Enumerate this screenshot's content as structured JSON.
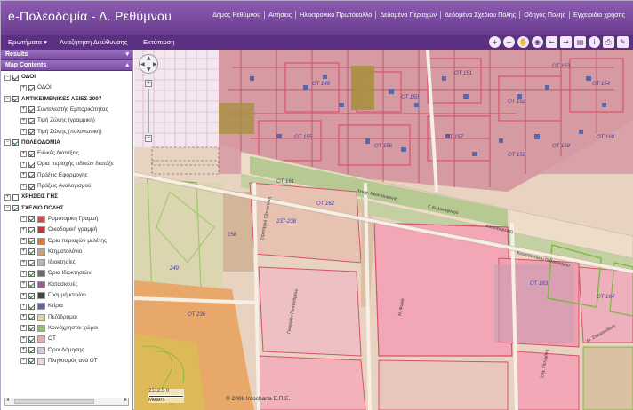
{
  "header": {
    "title": "e-Πολεοδομία - Δ. Ρεθύμνου",
    "nav": [
      "Δήμος Ρεθύμνου",
      "Αιτήσεις",
      "Ηλεκτρονικό Πρωτόκολλο",
      "Δεδομένα Περιοχών",
      "Δεδομένα Σχεδίου Πόλης",
      "Οδηγός Πόλης",
      "Εγχειρίδιο χρήσης"
    ]
  },
  "toolbar": {
    "menu_queries": "Ερωτήματα",
    "menu_address": "Αναζήτηση Διεύθυνσης",
    "menu_print": "Εκτύπωση",
    "tools": [
      "zoom-in-icon",
      "zoom-out-icon",
      "pan-hand-icon",
      "globe-icon",
      "back-arrow-icon",
      "forward-arrow-icon",
      "layers-icon",
      "info-icon",
      "print-icon",
      "measure-icon"
    ]
  },
  "left_panel": {
    "results_label": "Results",
    "map_contents_label": "Map Contents"
  },
  "tree": [
    {
      "label": "ΟΔΟΙ",
      "level": 0,
      "group": true,
      "checked": true,
      "expander": "−"
    },
    {
      "label": "ΟΔΟΙ",
      "level": 1,
      "checked": true,
      "expander": "+"
    },
    {
      "label": "ΑΝΤΙΚΕΙΜΕΝΙΚΕΣ ΑΞΙΕΣ 2007",
      "level": 0,
      "group": true,
      "checked": true,
      "expander": "−"
    },
    {
      "label": "Συντελεστής Εμπορικότητας",
      "level": 1,
      "checked": true,
      "expander": "+"
    },
    {
      "label": "Τιμή Ζώνης (γραμμική)",
      "level": 1,
      "checked": true,
      "expander": "+"
    },
    {
      "label": "Τιμή Ζώνης (πολυγωνική)",
      "level": 1,
      "checked": true,
      "expander": "+"
    },
    {
      "label": "ΠΟΛΕΟΔΟΜΙΑ",
      "level": 0,
      "group": true,
      "checked": true,
      "expander": "−"
    },
    {
      "label": "Ειδικές Διατάξεις",
      "level": 1,
      "checked": true,
      "expander": "+"
    },
    {
      "label": "Όρια περιοχής ειδικών διατάξε",
      "level": 1,
      "checked": true,
      "expander": "+"
    },
    {
      "label": "Πράξεις Εφαρμογής",
      "level": 1,
      "checked": true,
      "expander": "+"
    },
    {
      "label": "Πράξεις Αναλογισμού",
      "level": 1,
      "checked": true,
      "expander": "+"
    },
    {
      "label": "ΧΡΗΣΕΙΣ ΓΗΣ",
      "level": 0,
      "group": true,
      "checked": false,
      "expander": "+"
    },
    {
      "label": "ΣΧΕΔΙΟ ΠΟΛΗΣ",
      "level": 0,
      "group": true,
      "checked": true,
      "expander": "−"
    },
    {
      "label": "Ρυμοτομική Γραμμή",
      "level": 1,
      "checked": true,
      "expander": "+",
      "legend": "#d84848"
    },
    {
      "label": "Οικοδομική γραμμή",
      "level": 1,
      "checked": true,
      "expander": "+",
      "legend": "#cc3333"
    },
    {
      "label": "Όρια περιοχών μελέτης",
      "level": 1,
      "checked": true,
      "expander": "+",
      "legend": "#e07a2a"
    },
    {
      "label": "Κτηματολόγιο",
      "level": 1,
      "checked": true,
      "expander": "+",
      "legend": "#c9a27a"
    },
    {
      "label": "Ιδιοκτησίες",
      "level": 1,
      "checked": true,
      "expander": "+",
      "legend": "#b7b7b7"
    },
    {
      "label": "Όρια Ιδιοκτησιών",
      "level": 1,
      "checked": true,
      "expander": "+",
      "legend": "#6a6a6a"
    },
    {
      "label": "Κατασκευές",
      "level": 1,
      "checked": true,
      "expander": "+",
      "legend": "#a05a9a"
    },
    {
      "label": "Γραμμή κτιρίου",
      "level": 1,
      "checked": true,
      "expander": "+",
      "legend": "#444444"
    },
    {
      "label": "Κτίρια",
      "level": 1,
      "checked": true,
      "expander": "+",
      "legend": "#5a67a8"
    },
    {
      "label": "Πεζόδρομοι",
      "level": 1,
      "checked": true,
      "expander": "+",
      "legend": "#e8d49a"
    },
    {
      "label": "Κοινόχρηστοι χώροι",
      "level": 1,
      "checked": true,
      "expander": "+",
      "legend": "#8fbf6a"
    },
    {
      "label": "ΟΤ",
      "level": 1,
      "checked": true,
      "expander": "+",
      "legend": "#f3a6b4"
    },
    {
      "label": "Όροι Δόμησης",
      "level": 1,
      "checked": true,
      "expander": "+",
      "legend": "#d9c7e6"
    },
    {
      "label": "Πληθυσμός ανά ΟΤ",
      "level": 1,
      "checked": true,
      "expander": "+",
      "legend": "#f6d3d9"
    }
  ],
  "map": {
    "scale_label": "2512.5 0",
    "scale_unit": "Meters",
    "copyright": "© 2008 Infocharta Ε.Π.Ε.",
    "block_labels": [
      "ΟΤ 149",
      "ΟΤ 150",
      "ΟΤ 151",
      "ΟΤ 152",
      "ΟΤ 153",
      "ΟΤ 154",
      "ΟΤ 155",
      "ΟΤ 156",
      "ΟΤ 157",
      "ΟΤ 158",
      "ΟΤ 159",
      "ΟΤ 160",
      "ΟΤ 161",
      "ΟΤ 162",
      "ΟΤ 163",
      "ΟΤ 164",
      "249",
      "258",
      "237-238",
      "ΟΤ 236"
    ],
    "street_labels": [
      "Λεωφ. Κουντουριώτη",
      "Γ. Καλοκαιρινού",
      "Κουντουριώτη",
      "Κωνσταντίνου Παλαιολόγου",
      "Στρατηγού Τζαννετάκη",
      "Γεωργίου Παπανδρέου",
      "Ν. Φωκά",
      "Μ. Σταυρουλάκη",
      "Ζαχ. Πετυχάκη"
    ]
  }
}
